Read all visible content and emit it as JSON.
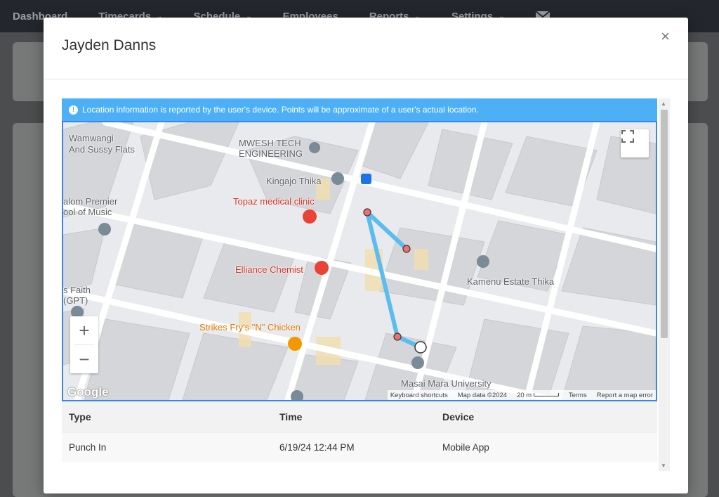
{
  "nav": {
    "items": [
      {
        "label": "Dashboard",
        "caret": false
      },
      {
        "label": "Timecards",
        "caret": true
      },
      {
        "label": "Schedule",
        "caret": true
      },
      {
        "label": "Employees",
        "caret": false
      },
      {
        "label": "Reports",
        "caret": true
      },
      {
        "label": "Settings",
        "caret": true
      }
    ],
    "mail_icon": "envelope-icon"
  },
  "modal": {
    "title": "Jayden Danns",
    "close_label": "×"
  },
  "map": {
    "info_text": "Location information is reported by the user's device. Points will be approximate of a user's actual location.",
    "labels": {
      "wamwangi": "Wamwangi",
      "sussy": "And Sussy Flats",
      "mwesh1": "MWESH TECH",
      "mwesh2": "ENGINEERING",
      "kingajo": "Kingajo Thika",
      "topaz": "Topaz medical clinic",
      "salom1": "alom Premier",
      "salom2": "ool of Music",
      "elliance": "Elliance Chemist",
      "kamenu": "Kamenu Estate Thika",
      "faith1": "s Faith",
      "faith2": "(GPT)",
      "strikes": "Strikes Fry's \"N\" Chicken",
      "masai": "Masai Mara University"
    },
    "zoom_in": "+",
    "zoom_out": "−",
    "google": "Google",
    "attribution": {
      "shortcuts": "Keyboard shortcuts",
      "mapdata": "Map data ©2024",
      "scale": "20 m",
      "terms": "Terms",
      "report": "Report a map error"
    },
    "route_color": "#5bbcf0"
  },
  "table": {
    "headers": {
      "type": "Type",
      "time": "Time",
      "device": "Device"
    },
    "rows": [
      {
        "type": "Punch In",
        "time": "6/19/24 12:44 PM",
        "device": "Mobile App"
      }
    ]
  }
}
